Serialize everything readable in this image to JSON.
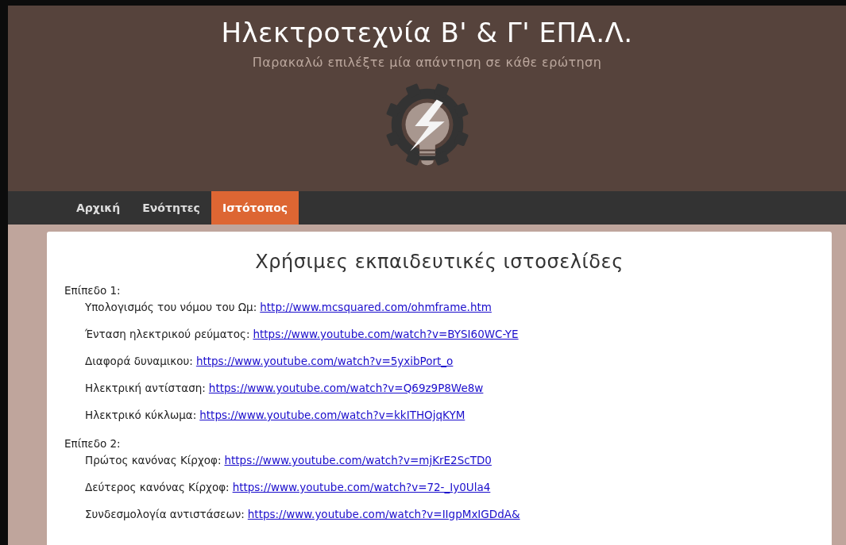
{
  "header": {
    "title": "Ηλεκτροτεχνία Β' & Γ' ΕΠΑ.Λ.",
    "subtitle": "Παρακαλώ επιλέξτε μία απάντηση σε κάθε ερώτηση"
  },
  "nav": [
    {
      "label": "Αρχική",
      "selected": false
    },
    {
      "label": "Ενότητες",
      "selected": false
    },
    {
      "label": "Ιστότοπος",
      "selected": true
    }
  ],
  "content": {
    "heading": "Χρήσιμες εκπαιδευτικές ιστοσελίδες",
    "levels": [
      {
        "label": "Επίπεδο 1:",
        "items": [
          {
            "label": "Υπολογισμός του νόμου του Ωμ:",
            "link": "http://www.mcsquared.com/ohmframe.htm"
          },
          {
            "label": "Ένταση ηλεκτρικού ρεύματος:",
            "link": "https://www.youtube.com/watch?v=BYSI60WC-YE"
          },
          {
            "label": "Διαφορά δυναμικου:",
            "link": "https://www.youtube.com/watch?v=5yxibPort_o"
          },
          {
            "label": "Ηλεκτρική αντίσταση:",
            "link": "https://www.youtube.com/watch?v=Q69z9P8We8w"
          },
          {
            "label": "Ηλεκτρικό κύκλωμα:",
            "link": "https://www.youtube.com/watch?v=kkITHOjqKYM"
          }
        ]
      },
      {
        "label": "Επίπεδο 2:",
        "items": [
          {
            "label": "Πρώτος κανόνας Κίρχοφ:",
            "link": "https://www.youtube.com/watch?v=mjKrE2ScTD0"
          },
          {
            "label": "Δεύτερος κανόνας Κίρχοφ:",
            "link": "https://www.youtube.com/watch?v=72-_Iy0Ula4"
          },
          {
            "label": "Συνδεσμολογία αντιστάσεων:",
            "link": "https://www.youtube.com/watch?v=IIgpMxIGDdA&"
          }
        ]
      }
    ]
  }
}
